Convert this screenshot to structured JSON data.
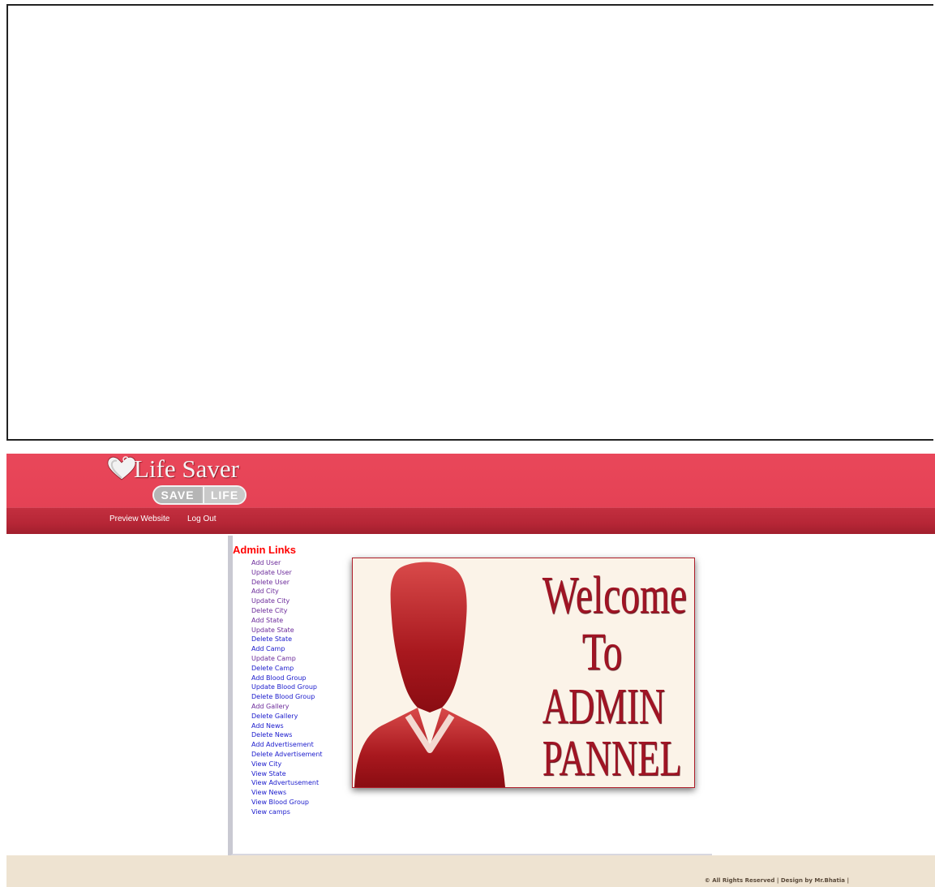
{
  "brand": {
    "name": "Life Saver",
    "tagline_left": "SAVE",
    "tagline_right": "LIFE",
    "primary_color": "#e9475a",
    "nav_color": "#b62636"
  },
  "nav": {
    "preview": "Preview Website",
    "logout": "Log Out"
  },
  "sidebar": {
    "title": "Admin Links",
    "links": [
      "Add User",
      "Update User",
      "Delete User",
      "Add City",
      "Update City",
      "Delete City",
      "Add State",
      "Update State",
      "Delete State",
      "Add Camp",
      "Update Camp",
      "Delete Camp",
      "Add Blood Group",
      "Update Blood Group",
      "Delete Blood Group",
      "Add Gallery",
      "Delete Gallery",
      "Add News",
      "Delete News",
      "Add Advertisement",
      "Delete Advertisement",
      "View City",
      "View State",
      "View Advertusement",
      "View News",
      "View Blood Group",
      "View camps"
    ]
  },
  "welcome": {
    "line1": "Welcome",
    "line2": "To",
    "line3": "ADMIN",
    "line4": "PANNEL"
  },
  "footer": {
    "text": "© All Rights Reserved | Design by Mr.Bhatia |"
  }
}
